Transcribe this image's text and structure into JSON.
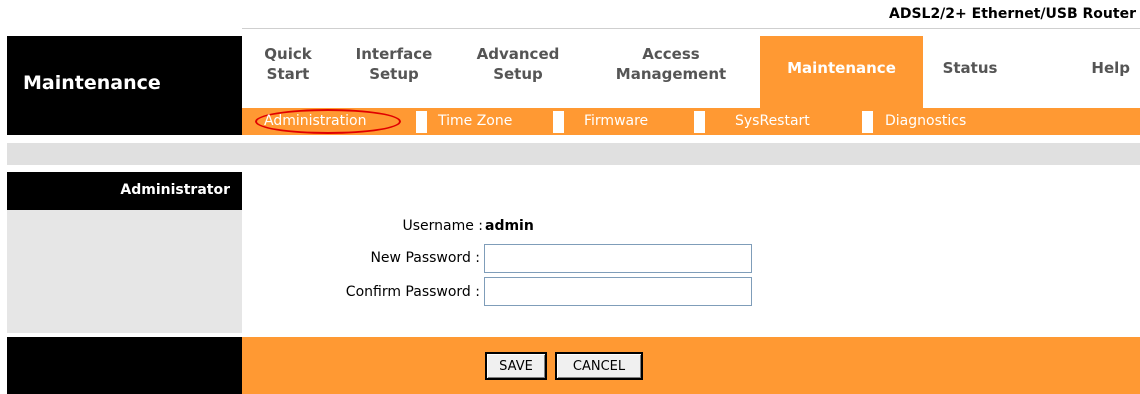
{
  "header": {
    "product": "ADSL2/2+ Ethernet/USB Router",
    "brand": "Maintenance"
  },
  "nav": {
    "quick_start": [
      "Quick",
      "Start"
    ],
    "interface_setup": [
      "Interface",
      "Setup"
    ],
    "advanced_setup": [
      "Advanced",
      "Setup"
    ],
    "access_management": [
      "Access",
      "Management"
    ],
    "maintenance": "Maintenance",
    "status": "Status",
    "help": "Help"
  },
  "subnav": {
    "administration": "Administration",
    "time_zone": "Time Zone",
    "firmware": "Firmware",
    "sysrestart": "SysRestart",
    "diagnostics": "Diagnostics"
  },
  "section": {
    "title": "Administrator"
  },
  "form": {
    "username_label": "Username :",
    "username_value": "admin",
    "new_password_label": "New Password :",
    "new_password_value": "",
    "confirm_password_label": "Confirm Password :",
    "confirm_password_value": ""
  },
  "buttons": {
    "save": "SAVE",
    "cancel": "CANCEL"
  },
  "colors": {
    "accent": "#ff9933",
    "highlight_oval": "#e00000",
    "dark": "#000000"
  }
}
